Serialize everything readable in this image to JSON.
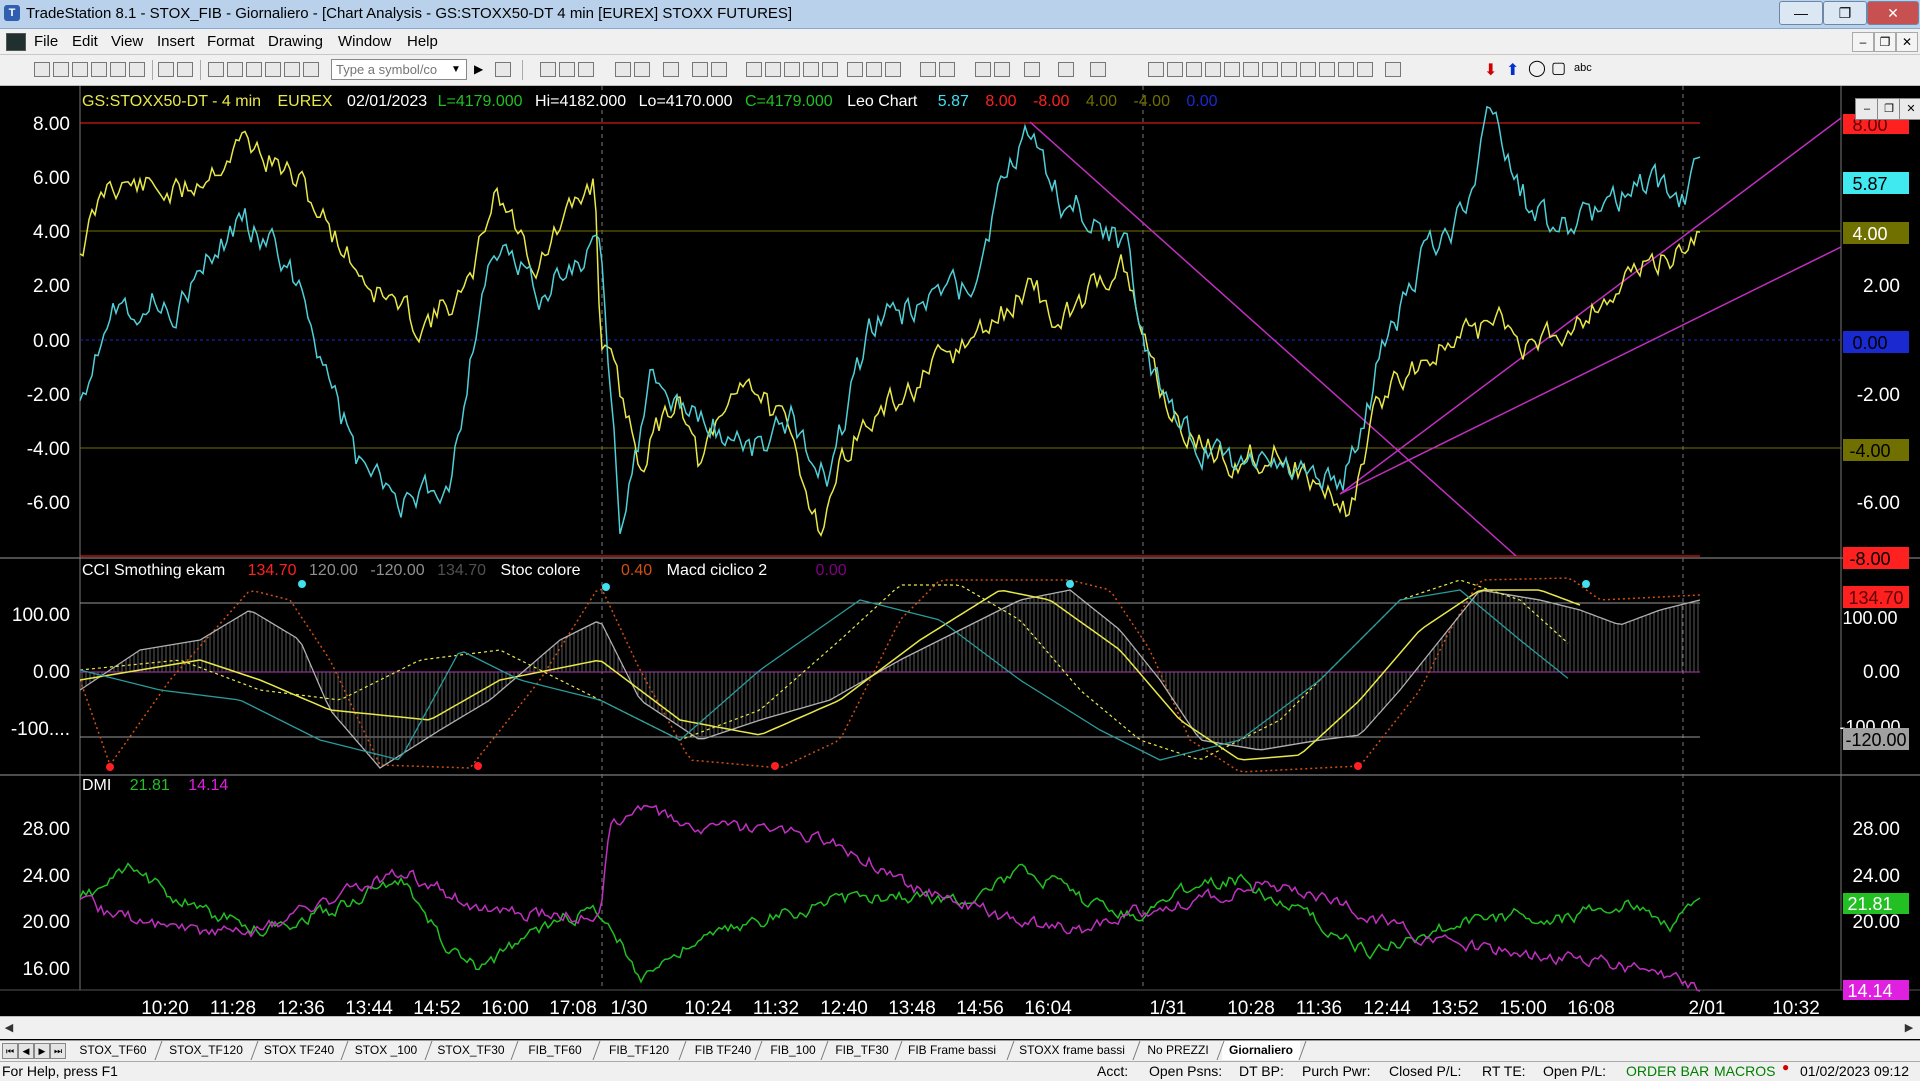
{
  "window": {
    "title": "TradeStation 8.1 - STOX_FIB - Giornaliero - [Chart Analysis - GS:STOXX50-DT  4 min  [EUREX] STOXX FUTURES]",
    "minimize": "—",
    "maximize": "❐",
    "close": "✕"
  },
  "menu": [
    "File",
    "Edit",
    "View",
    "Insert",
    "Format",
    "Drawing",
    "Window",
    "Help"
  ],
  "mdi_controls": {
    "minimize": "–",
    "restore": "❐",
    "close": "✕"
  },
  "toolbar": {
    "symbol_placeholder": "Type a symbol/co",
    "text_tool": "abc"
  },
  "price_pane": {
    "header": {
      "symbol": "GS:STOXX50-DT - 4 min",
      "exchange": "EUREX",
      "date": "02/01/2023",
      "last": "L=4179.000",
      "high": "Hi=4182.000",
      "low": "Lo=4170.000",
      "close": "C=4179.000",
      "study": "Leo Chart",
      "v1": "5.87",
      "v2": "8.00",
      "v3": "-8.00",
      "v4": "4.00",
      "v5": "-4.00",
      "v6": "0.00"
    },
    "y_ticks": [
      "8.00",
      "6.00",
      "4.00",
      "2.00",
      "0.00",
      "-2.00",
      "-4.00",
      "-6.00"
    ],
    "tags": {
      "upper": "8.00",
      "cyan": "5.87",
      "olive_up": "4.00",
      "zero": "0.00",
      "olive_down": "-4.00",
      "lower": "-8.00"
    }
  },
  "cci_pane": {
    "header": {
      "name": "CCI Smothing ekam",
      "v1": "134.70",
      "v2": "120.00",
      "v3": "-120.00",
      "v4": "134.70",
      "stoc": "Stoc colore",
      "stoc_val": "0.40",
      "macd": "Macd ciclico 2",
      "macd_val": "0.00"
    },
    "y_ticks": [
      "100.00",
      "0.00",
      "-100...."
    ],
    "tags": {
      "cci": "134.70",
      "upper": "100.00",
      "zero": "0.00",
      "lower_hidden": "-100.00",
      "lower": "-120.00"
    }
  },
  "dmi_pane": {
    "header": {
      "name": "DMI",
      "plus": "21.81",
      "minus": "14.14"
    },
    "y_ticks": [
      "28.00",
      "24.00",
      "20.00",
      "16.00"
    ],
    "tags": {
      "plus": "21.81",
      "minus": "14.14"
    }
  },
  "time_axis": [
    "10:20",
    "11:28",
    "12:36",
    "13:44",
    "14:52",
    "16:00",
    "17:08",
    "1/30",
    "10:24",
    "11:32",
    "12:40",
    "13:48",
    "14:56",
    "16:04",
    "1/31",
    "10:28",
    "11:36",
    "12:44",
    "13:52",
    "15:00",
    "16:08",
    "2/01",
    "10:32"
  ],
  "tabs": [
    "STOX_TF60",
    "STOX_TF120",
    "STOX TF240",
    "STOX _100",
    "STOX_TF30",
    "FIB_TF60",
    "FIB_TF120",
    "FIB TF240",
    "FIB_100",
    "FIB_TF30",
    "FIB Frame bassi",
    "STOXX frame bassi",
    "No PREZZI",
    "Giornaliero"
  ],
  "active_tab": "Giornaliero",
  "status": {
    "help": "For Help, press F1",
    "acct": "Acct:",
    "open_psns": "Open Psns:",
    "dt_bp": "DT BP:",
    "purch_pwr": "Purch Pwr:",
    "closed_pl": "Closed P/L:",
    "rt_te": "RT TE:",
    "open_pl": "Open P/L:",
    "order_bar": "ORDER BAR",
    "macros": "MACROS",
    "datetime": "01/02/2023 09:12"
  },
  "colors": {
    "cyan": "#4fd0d8",
    "yellow": "#e8e84a",
    "magenta": "#d040d0",
    "green": "#22c022",
    "red": "#ff2020",
    "olive": "#707000",
    "blue": "#1a2ad0",
    "bg": "#000000"
  }
}
